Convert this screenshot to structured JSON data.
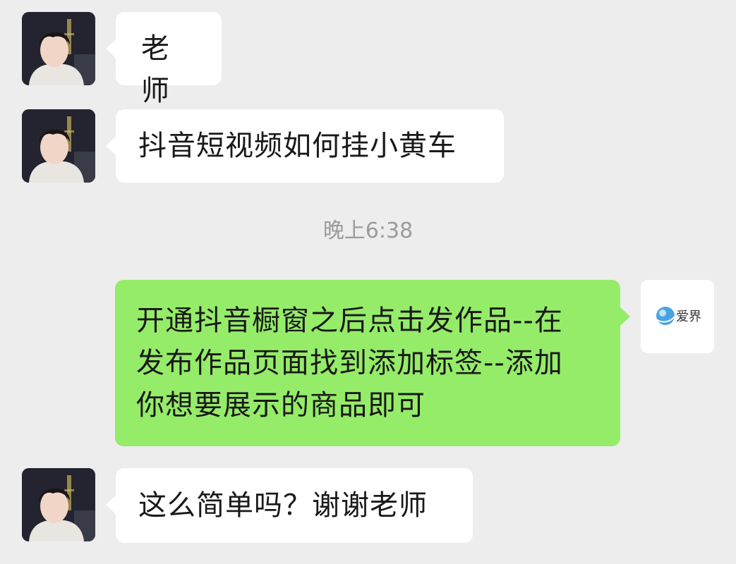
{
  "messages": [
    {
      "sender": "contact",
      "text": "老师"
    },
    {
      "sender": "contact",
      "text": "抖音短视频如何挂小黄车"
    },
    {
      "sender": "me",
      "lines": [
        "开通抖音橱窗之后点击发作品--在",
        "发布作品页面找到添加标签--添加",
        "你想要展示的商品即可"
      ]
    },
    {
      "sender": "contact",
      "text": "这么简单吗？谢谢老师"
    }
  ],
  "timestamp": "晚上6:38",
  "self_avatar_logo": "爱界",
  "colors": {
    "background": "#ededed",
    "incoming_bubble": "#ffffff",
    "outgoing_bubble": "#95ec69",
    "timestamp_text": "#9b9b9b"
  },
  "icons": {
    "contact_avatar": "contact-avatar-photo",
    "self_avatar": "blue-globe-logo"
  }
}
